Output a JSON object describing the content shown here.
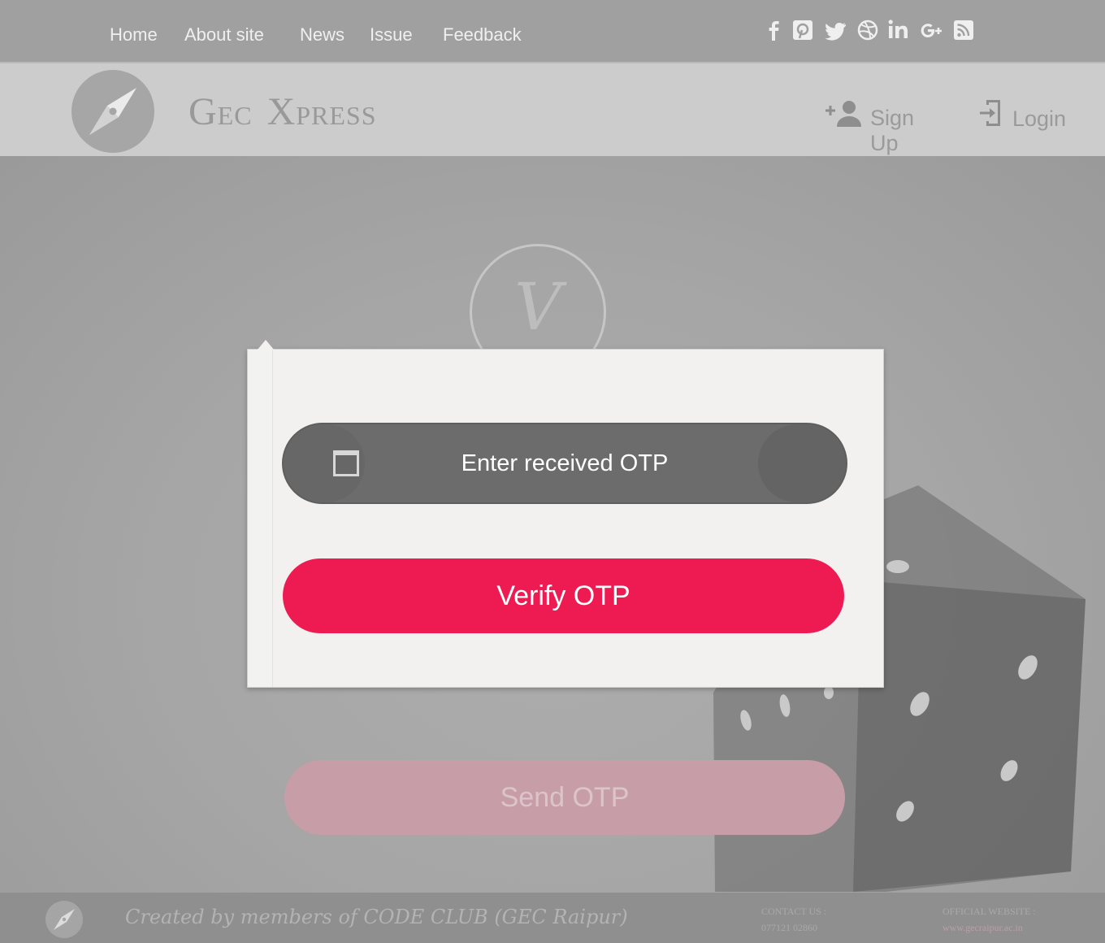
{
  "topnav": {
    "items": [
      "Home",
      "About site",
      "News",
      "Issue",
      "Feedback"
    ],
    "social_icons": [
      "facebook-icon",
      "pinterest-icon",
      "twitter-icon",
      "dribbble-icon",
      "linkedin-icon",
      "google-plus-icon",
      "rss-icon"
    ]
  },
  "header": {
    "brand_icon": "compass-icon",
    "brand_first_initial": "G",
    "brand_first_rest": "EC",
    "brand_second_initial": "X",
    "brand_second_rest": "PRESS",
    "signup_label": "Sign Up",
    "login_label": "Login"
  },
  "main": {
    "logo_letter": "V",
    "send_otp_label": "Send OTP"
  },
  "modal": {
    "otp_placeholder": "Enter received OTP",
    "verify_label": "Verify OTP"
  },
  "footer": {
    "credit": "Created by members of CODE CLUB (GEC Raipur)",
    "contact_label": "CONTACT US :",
    "contact_value": "077121 02860",
    "website_label": "OFFICIAL WEBSITE :",
    "website_value": "www.gecraipur.ac.in"
  },
  "colors": {
    "accent": "#ee1b52",
    "input_bg": "#6c6c6c",
    "modal_bg": "#f2f1ef"
  }
}
